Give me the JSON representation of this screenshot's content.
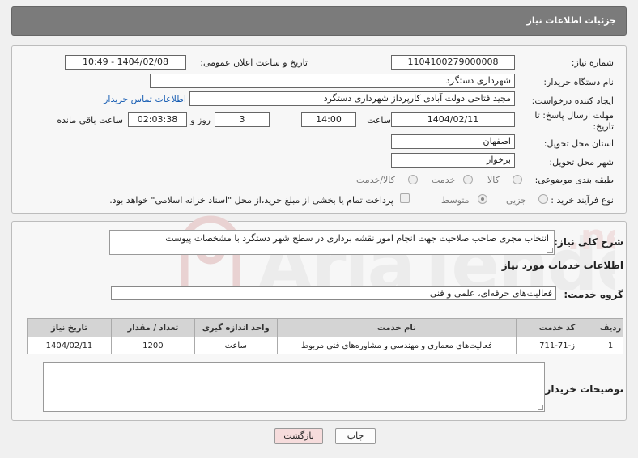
{
  "header": {
    "title": "جزئیات اطلاعات نیاز"
  },
  "form": {
    "need_number_label": "شماره نیاز:",
    "need_number": "1104100279000008",
    "announce_label": "تاریخ و ساعت اعلان عمومی:",
    "announce_value": "1404/02/08 - 10:49",
    "buyer_org_label": "نام دستگاه خریدار:",
    "buyer_org": "شهرداری دستگرد",
    "creator_label": "ایجاد کننده درخواست:",
    "creator": "مجید فتاحی دولت آبادی کارپرداز شهرداری دستگرد",
    "contact_link": "اطلاعات تماس خریدار",
    "deadline_label_1": "مهلت ارسال پاسخ: تا",
    "deadline_label_2": "تاریخ:",
    "deadline_date": "1404/02/11",
    "time_label": "ساعت",
    "deadline_time": "14:00",
    "days_value": "3",
    "days_label": "روز و",
    "remaining_time": "02:03:38",
    "remaining_label": "ساعت باقی مانده",
    "province_label": "استان محل تحویل:",
    "province": "اصفهان",
    "city_label": "شهر محل تحویل:",
    "city": "برخوار",
    "category_label": "طبقه بندی موضوعی:",
    "category_options": [
      "کالا",
      "خدمت",
      "کالا/خدمت"
    ],
    "process_label": "نوع فرآیند خرید :",
    "process_options": [
      "جزیی",
      "متوسط"
    ],
    "payment_note": "پرداخت تمام یا بخشی از مبلغ خرید،از محل \"اسناد خزانه اسلامی\" خواهد بود."
  },
  "summary": {
    "label": "شرح کلی نیاز:",
    "text": "انتخاب مجری صاحب صلاحیت جهت انجام امور نقشه برداری در سطح شهر دستگرد با مشخصات پیوست"
  },
  "services": {
    "title": "اطلاعات خدمات مورد نیاز",
    "group_label": "گروه خدمت:",
    "group_value": "فعالیت‌های حرفه‌ای، علمی و فنی",
    "columns": [
      "ردیف",
      "کد خدمت",
      "نام خدمت",
      "واحد اندازه گیری",
      "تعداد / مقدار",
      "تاریخ نیاز"
    ],
    "rows": [
      [
        "1",
        "ز-71-711",
        "فعالیت‌های معماری و مهندسی و مشاوره‌های فنی مربوط",
        "ساعت",
        "1200",
        "1404/02/11"
      ]
    ]
  },
  "buyer_notes": {
    "label": "توضیحات خریدار:"
  },
  "buttons": {
    "print": "چاپ",
    "back": "بازگشت"
  },
  "colors": {
    "header_bg": "#7b7b7b",
    "link": "#1a5fb4",
    "back_btn_bg": "#f6dcdc"
  }
}
